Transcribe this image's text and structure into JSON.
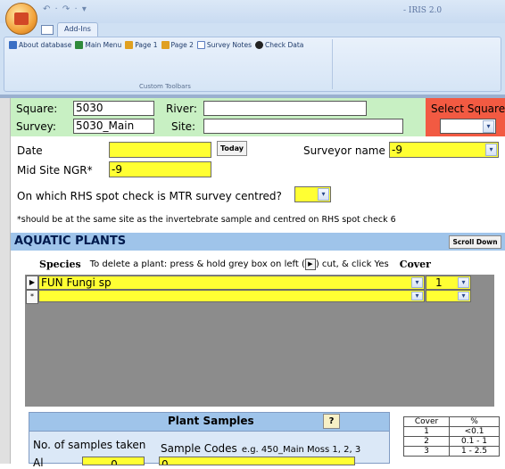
{
  "app": {
    "title": "- IRIS 2.0",
    "qat_glyphs": "↶ · ↷ · ▾"
  },
  "ribbon": {
    "tab": "Add-Ins",
    "items": [
      {
        "label": "About database",
        "icon": "info-icon",
        "color": "#3a6fc4"
      },
      {
        "label": "Main Menu",
        "icon": "grid-icon",
        "color": "#2f8a3b"
      },
      {
        "label": "Page 1",
        "icon": "page-icon",
        "color": "#e0a020"
      },
      {
        "label": "Page 2",
        "icon": "page-icon",
        "color": "#e0a020"
      },
      {
        "label": "Survey Notes",
        "icon": "notes-icon",
        "color": "#5d7ec0"
      },
      {
        "label": "Check Data",
        "icon": "eye-icon",
        "color": "#222222"
      }
    ],
    "group_label": "Custom Toolbars"
  },
  "header": {
    "square_label": "Square:",
    "square_value": "5030",
    "river_label": "River:",
    "river_value": "",
    "survey_label": "Survey:",
    "survey_value": "5030_Main",
    "site_label": "Site:",
    "site_value": "",
    "select_square_label": "Select Square",
    "select_square_value": ""
  },
  "form": {
    "date_label": "Date",
    "date_value": "",
    "today_button": "Today",
    "surveyor_label": "Surveyor name",
    "surveyor_value": "-9",
    "ngr_label": "Mid Site NGR*",
    "ngr_value": "-9",
    "spot_check_question": "On which RHS spot check is MTR survey centred?",
    "spot_check_value": "",
    "note": "*should be at the same site as the invertebrate sample and centred on RHS spot check 6"
  },
  "aquatic": {
    "title": "AQUATIC PLANTS",
    "scroll_button": "Scroll Down",
    "species_header": "Species",
    "instructions_1": "To delete a plant: press & hold grey box on left (",
    "instructions_2": ") cut, & click Yes",
    "cover_header": "Cover",
    "rows": [
      {
        "selector": "▶",
        "species": "FUN Fungi sp",
        "cover": "1"
      },
      {
        "selector": "*",
        "species": "",
        "cover": ""
      }
    ]
  },
  "plant_samples": {
    "title": "Plant Samples",
    "help_icon_glyph": "?",
    "count_label": "No. of samples taken",
    "codes_label": "Sample Codes",
    "codes_example": "e.g. 450_Main Moss 1, 2, 3",
    "partial_label": "Al",
    "partial_value_1": "0",
    "partial_value_2": "0"
  },
  "cover_table": {
    "headers": [
      "Cover",
      "%"
    ],
    "rows": [
      [
        "1",
        "<0.1"
      ],
      [
        "2",
        "0.1 - 1"
      ],
      [
        "3",
        "1 - 2.5"
      ]
    ]
  },
  "colors": {
    "field_yellow": "#ffff33",
    "header_green": "#c8f0c3",
    "select_red": "#f25a42",
    "section_blue": "#9fc4ea"
  }
}
